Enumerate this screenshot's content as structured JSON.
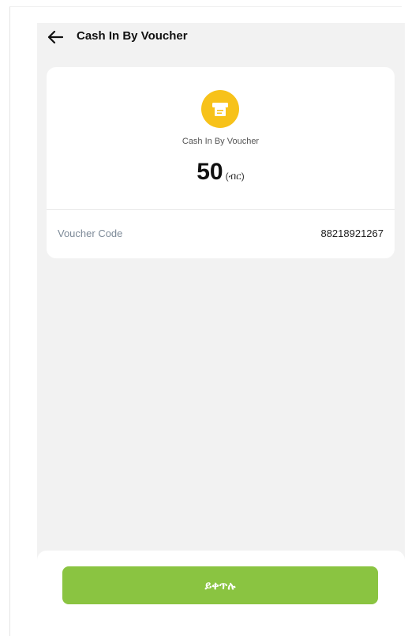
{
  "header": {
    "title": "Cash In By Voucher",
    "back_icon": "arrow-left-icon"
  },
  "card": {
    "icon": "voucher-icon",
    "icon_color": "#f7c21a",
    "title": "Cash In By Voucher",
    "amount": "50",
    "currency": "(ብር)",
    "details": [
      {
        "label": "Voucher Code",
        "value": "88218921267"
      }
    ]
  },
  "footer": {
    "continue_label": "ይቀጥሉ",
    "button_color": "#8ac441"
  }
}
